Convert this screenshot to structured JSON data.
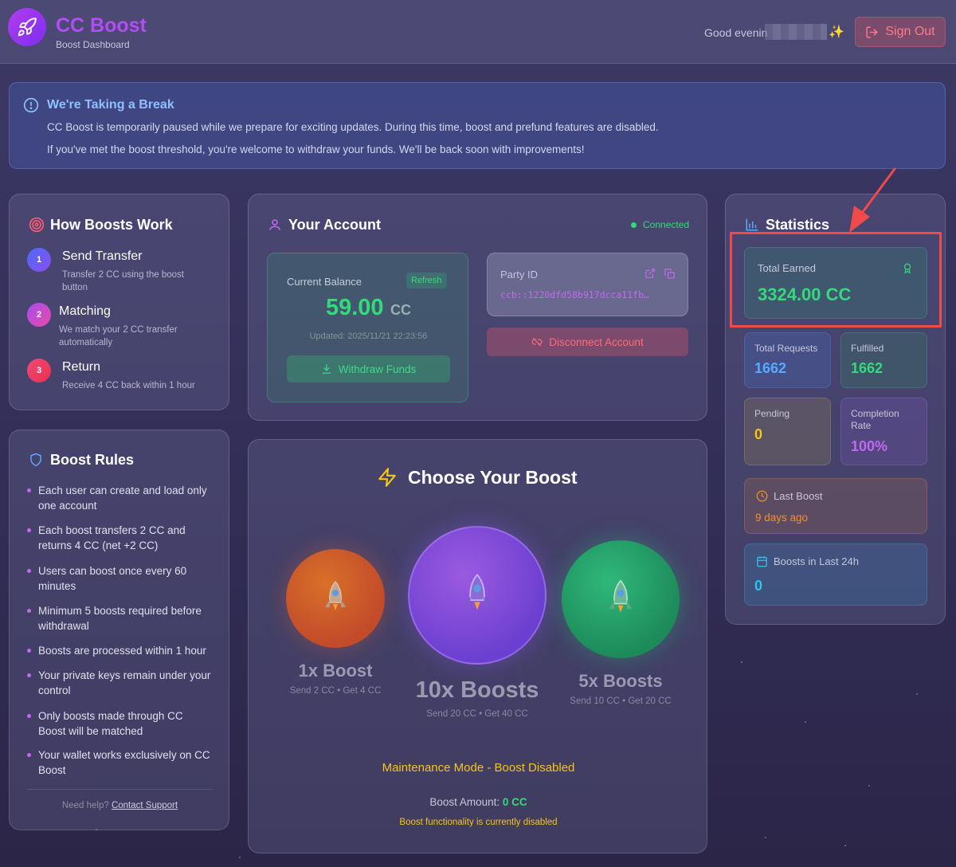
{
  "header": {
    "brand": "CC Boost",
    "subtitle": "Boost Dashboard",
    "greeting": "Good evenin",
    "sign_out": "Sign Out"
  },
  "banner": {
    "title": "We're Taking a Break",
    "line1": "CC Boost is temporarily paused while we prepare for exciting updates. During this time, boost and prefund features are disabled.",
    "line2": "If you've met the boost threshold, you're welcome to withdraw your funds. We'll be back soon with improvements!"
  },
  "how": {
    "title": "How Boosts Work",
    "steps": [
      {
        "num": "1",
        "title": "Send Transfer",
        "desc": "Transfer 2 CC using the boost button"
      },
      {
        "num": "2",
        "title": "Matching",
        "desc": "We match your 2 CC transfer automatically"
      },
      {
        "num": "3",
        "title": "Return",
        "desc": "Receive 4 CC back within 1 hour"
      }
    ]
  },
  "rules": {
    "title": "Boost Rules",
    "items": [
      "Each user can create and load only one account",
      "Each boost transfers 2 CC and returns 4 CC (net +2 CC)",
      "Users can boost once every 60 minutes",
      "Minimum 5 boosts required before withdrawal",
      "Boosts are processed within 1 hour",
      "Your private keys remain under your control",
      "Only boosts made through CC Boost will be matched",
      "Your wallet works exclusively on CC Boost"
    ],
    "help_text": "Need help?",
    "help_link": "Contact Support"
  },
  "account": {
    "title": "Your Account",
    "status": "Connected",
    "balance_label": "Current Balance",
    "refresh": "Refresh",
    "balance": "59.00",
    "currency": "CC",
    "updated": "Updated: 2025/11/21 22:23:56",
    "withdraw": "Withdraw Funds",
    "party_label": "Party ID",
    "party_id": "ccb::1220dfd58b917dcca11fb…",
    "disconnect": "Disconnect Account"
  },
  "boost": {
    "title": "Choose Your Boost",
    "options": [
      {
        "name": "1x Boost",
        "desc": "Send 2 CC • Get 4 CC"
      },
      {
        "name": "10x Boosts",
        "desc": "Send 20 CC • Get 40 CC"
      },
      {
        "name": "5x Boosts",
        "desc": "Send 10 CC • Get 20 CC"
      }
    ],
    "maintenance": "Maintenance Mode - Boost Disabled",
    "amount_label": "Boost Amount:",
    "amount_value": "0 CC",
    "disabled_note": "Boost functionality is currently disabled"
  },
  "stats": {
    "title": "Statistics",
    "total_earned_label": "Total Earned",
    "total_earned": "3324.00 CC",
    "total_requests_label": "Total Requests",
    "total_requests": "1662",
    "fulfilled_label": "Fulfilled",
    "fulfilled": "1662",
    "pending_label": "Pending",
    "pending": "0",
    "completion_label": "Completion Rate",
    "completion": "100%",
    "last_boost_label": "Last Boost",
    "last_boost": "9 days ago",
    "last24_label": "Boosts in Last 24h",
    "last24": "0"
  },
  "colors": {
    "accent_purple": "#b44cf5",
    "green": "#34d97b",
    "blue": "#5aa8ff",
    "yellow": "#f5c518",
    "orange": "#f2902a",
    "cyan": "#2ec4f0",
    "red_annotation": "#f04a4a"
  }
}
